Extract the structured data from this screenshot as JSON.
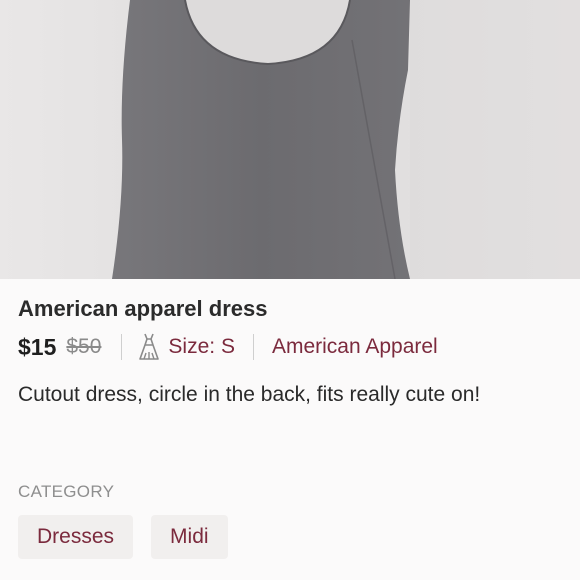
{
  "listing": {
    "title": "American apparel dress",
    "price": "$15",
    "original_price": "$50",
    "size_label": "Size: S",
    "brand": "American Apparel",
    "description": "Cutout dress, circle in the back, fits really cute on!"
  },
  "category": {
    "heading": "CATEGORY",
    "tags": [
      "Dresses",
      "Midi"
    ]
  },
  "icons": {
    "size": "dress-icon"
  },
  "colors": {
    "accent": "#7b2a3d",
    "photo_background": "#e4e2e2",
    "dress_fabric": "#6f6e72"
  }
}
